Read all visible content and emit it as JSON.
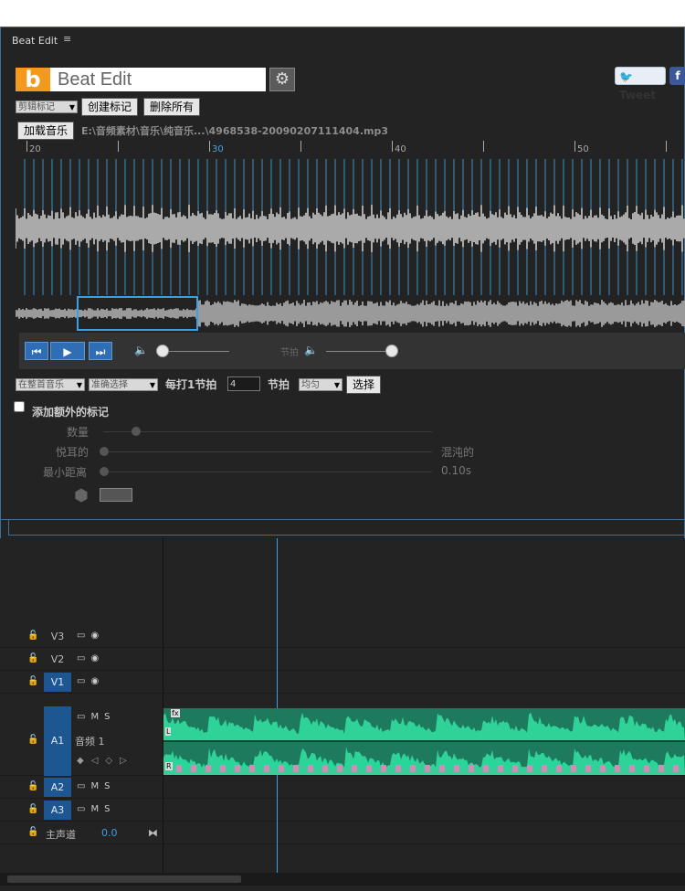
{
  "top_gap": "",
  "panel": {
    "tab_title": "Beat Edit",
    "menu_icon": "≡",
    "logo_letter": "b",
    "title": "Beat Edit",
    "gear_icon": "gear-icon",
    "tweet_label": "Tweet",
    "facebook_label": "f",
    "marker_select": "剪辑标记",
    "create_marker": "创建标记",
    "delete_all": "删除所有",
    "load_music": "加载音乐",
    "file_path": "E:\\音频素材\\音乐\\纯音乐...\\4968538-20090207111404.mp3",
    "ruler": [
      {
        "label": "20",
        "highlight": false
      },
      {
        "label": "30",
        "highlight": true
      },
      {
        "label": "40",
        "highlight": false
      },
      {
        "label": "50",
        "highlight": false
      }
    ],
    "transport": {
      "prev_icon": "skip-back-icon",
      "play_icon": "play-icon",
      "next_icon": "skip-forward-icon",
      "volume_icon": "volume-icon",
      "beat_label": "节拍",
      "volume_level": 0.0,
      "beat_volume_level": 1.0
    },
    "options": {
      "source_select": "在整首音乐",
      "mode_select": "准确选择",
      "every_label": "每打1节拍",
      "beat_value": "4",
      "beat_unit": "节拍",
      "dist_select": "均匀",
      "select_button": "选择"
    },
    "extra": {
      "checkbox_label": "添加额外的标记",
      "checked": false,
      "count_label": "数量",
      "pleasant_label": "悦耳的",
      "chaotic_label": "混沌的",
      "min_dist_label": "最小距离",
      "min_dist_value": "0.10s"
    }
  },
  "timeline": {
    "tracks": [
      {
        "name": "V3",
        "active": false,
        "type": "video"
      },
      {
        "name": "V2",
        "active": false,
        "type": "video"
      },
      {
        "name": "V1",
        "active": true,
        "type": "video"
      },
      {
        "name": "A1",
        "active": true,
        "type": "audio",
        "clip_name": "音频 1",
        "m": "M",
        "s": "S"
      },
      {
        "name": "A2",
        "active": true,
        "type": "audio",
        "m": "M",
        "s": "S"
      },
      {
        "name": "A3",
        "active": true,
        "type": "audio",
        "m": "M",
        "s": "S"
      }
    ],
    "master_label": "主声道",
    "master_value": "0.0",
    "clip_fx": "fx",
    "channel_l": "L",
    "channel_r": "R",
    "clip_color": "#2fd39a"
  }
}
